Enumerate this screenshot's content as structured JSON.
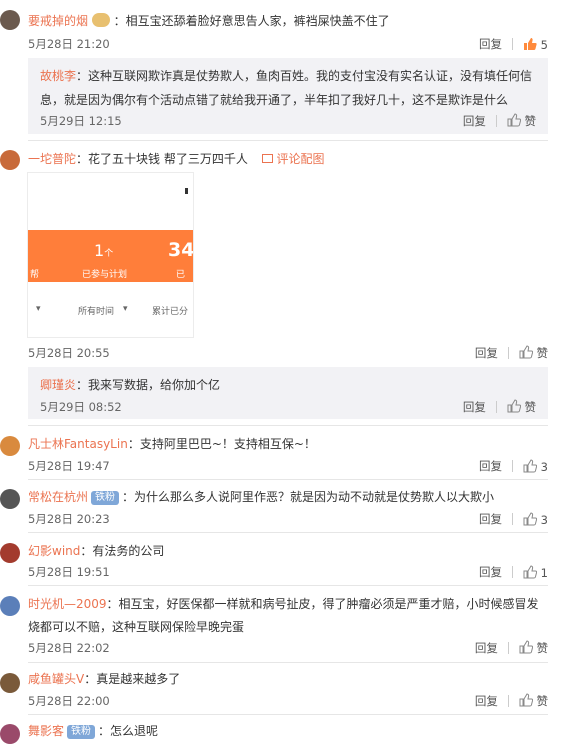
{
  "comments": [
    {
      "name": "要戒掉的烟",
      "text": "：相互宝还舔着脸好意思告人家，裤裆屎快盖不住了",
      "time": "5月28日 21:20",
      "reply": "回复",
      "likes": "5"
    },
    {
      "reply_name": "故桃李",
      "reply_text": "：这种互联网欺诈真是仗势欺人，鱼肉百姓。我的支付宝没有实名认证，没有填任何信息，就是因为偶尔有个活动点错了就给我开通了，半年扣了我好几十，这不是欺诈是什么",
      "time": "5月29日 12:15",
      "reply": "回复",
      "like_label": "赞"
    },
    {
      "name": "一坨普陀",
      "text": "：花了五十块钱 帮了三万四千人",
      "pic_link": "评论配图",
      "time": "5月28日 20:55",
      "reply": "回复",
      "like_label": "赞",
      "pic": {
        "stat1_num": "1",
        "stat1_unit": "个",
        "stat1_label": "已参与计划",
        "stat2_num": "34",
        "stat2_label": "已帮",
        "left_label": "帮",
        "filter1": "所有时间",
        "filter2": "累计已分",
        "chevron": "▾"
      }
    },
    {
      "reply_name": "卿瑾炎",
      "reply_text": "：我来写数据，给你加个亿",
      "time": "5月29日 08:52",
      "reply": "回复",
      "like_label": "赞"
    },
    {
      "name": "凡士林FantasyLin",
      "text": "：支持阿里巴巴~！支持相互保~！",
      "time": "5月28日 19:47",
      "reply": "回复",
      "likes": "3"
    },
    {
      "name": "常松在杭州",
      "tag": "铁粉",
      "text": "：为什么那么多人说阿里作恶？就是因为动不动就是仗势欺人以大欺小",
      "time": "5月28日 20:23",
      "reply": "回复",
      "likes": "3"
    },
    {
      "name": "幻影wind",
      "text": "：有法务的公司",
      "time": "5月28日 19:51",
      "reply": "回复",
      "likes": "1"
    },
    {
      "name": "时光机—2009",
      "text": "：相互宝，好医保都一样就和病号扯皮，得了肿瘤必须是严重才赔，小时候感冒发烧都可以不赔，这种互联网保险早晚完蛋",
      "time": "5月28日 22:02",
      "reply": "回复",
      "like_label": "赞"
    },
    {
      "name": "咸鱼罐头V",
      "text": "：真是越来越多了",
      "time": "5月28日 22:00",
      "reply": "回复",
      "like_label": "赞"
    },
    {
      "name": "舞影客",
      "tag": "铁粉",
      "text": "：怎么退呢"
    }
  ],
  "colors": {
    "name": "#eb7350",
    "tag": "#7fa7d8",
    "orange": "#ff7e3a"
  }
}
